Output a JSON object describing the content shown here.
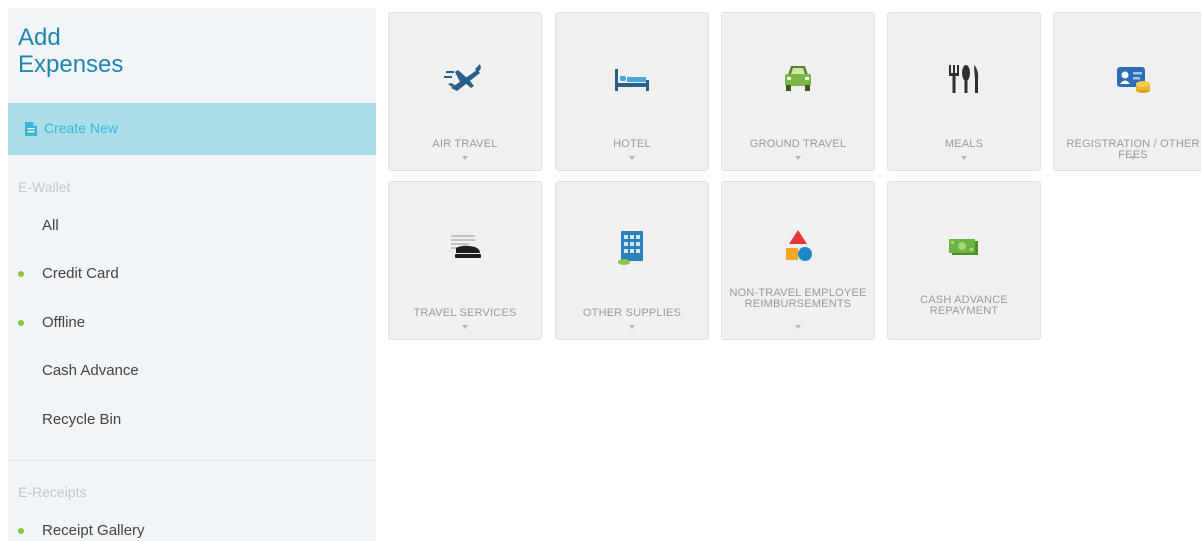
{
  "sidebar": {
    "title_line1": "Add",
    "title_line2": "Expenses",
    "create_new": "Create New",
    "ewallet": {
      "heading": "E-Wallet",
      "items": [
        {
          "label": "All",
          "dot": false
        },
        {
          "label": "Credit Card",
          "dot": true
        },
        {
          "label": "Offline",
          "dot": true
        },
        {
          "label": "Cash Advance",
          "dot": false
        },
        {
          "label": "Recycle Bin",
          "dot": false
        }
      ]
    },
    "ereceipts": {
      "heading": "E-Receipts",
      "items": [
        {
          "label": "Receipt Gallery",
          "dot": true
        }
      ]
    }
  },
  "tiles": [
    {
      "label": "AIR TRAVEL",
      "icon": "airplane-icon",
      "chevron": true
    },
    {
      "label": "HOTEL",
      "icon": "bed-icon",
      "chevron": true
    },
    {
      "label": "GROUND TRAVEL",
      "icon": "car-icon",
      "chevron": true
    },
    {
      "label": "MEALS",
      "icon": "utensils-icon",
      "chevron": true
    },
    {
      "label": "REGISTRATION / OTHER FEES",
      "icon": "id-card-coins-icon",
      "chevron": true
    },
    {
      "label": "TRAVEL SERVICES",
      "icon": "stapler-icon",
      "chevron": true
    },
    {
      "label": "OTHER SUPPLIES",
      "icon": "building-icon",
      "chevron": true
    },
    {
      "label": "NON-TRAVEL EMPLOYEE REIMBURSEMENTS",
      "icon": "shapes-icon",
      "chevron": true
    },
    {
      "label": "CASH ADVANCE REPAYMENT",
      "icon": "cash-icon",
      "chevron": false
    }
  ],
  "colors": {
    "accent": "#1f86b2",
    "create_new_bg": "#a9dde8",
    "create_new_text": "#3ab5d6",
    "dot_green": "#8bc34a",
    "tile_bg": "#f0f0f0"
  }
}
